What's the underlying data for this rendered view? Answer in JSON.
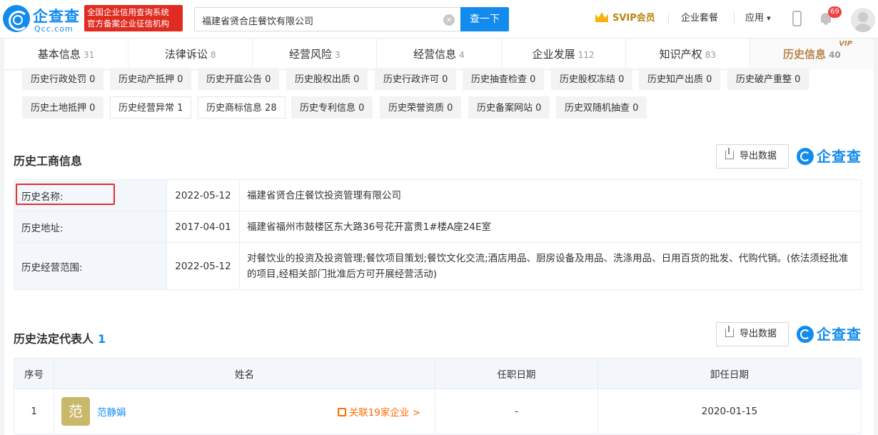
{
  "header": {
    "logo_cn": "企查查",
    "logo_en": "Qcc.com",
    "badge_line1": "全国企业信用查询系统",
    "badge_line2": "官方备案企业征信机构",
    "search_value": "福建省贤合庄餐饮有限公司",
    "search_button": "查一下",
    "svip": "SVIP会员",
    "package": "企业套餐",
    "apps": "应用",
    "apps_caret": "▾",
    "notif_count": "69"
  },
  "tabs": [
    {
      "label": "基本信息",
      "count": "31"
    },
    {
      "label": "法律诉讼",
      "count": "8"
    },
    {
      "label": "经营风险",
      "count": "3"
    },
    {
      "label": "经营信息",
      "count": "4"
    },
    {
      "label": "企业发展",
      "count": "112"
    },
    {
      "label": "知识产权",
      "count": "83"
    },
    {
      "label": "历史信息",
      "count": "40",
      "vip": "VIP"
    }
  ],
  "subtags": [
    "历史行政处罚 0",
    "历史动产抵押 0",
    "历史开庭公告 0",
    "历史股权出质 0",
    "历史行政许可 0",
    "历史抽查检查 0",
    "历史股权冻结 0",
    "历史知产出质 0",
    "历史破产重整 0",
    "历史土地抵押 0",
    "历史经营异常 1",
    "历史商标信息 28",
    "历史专利信息 0",
    "历史荣誉资质 0",
    "历史备案网站 0",
    "历史双随机抽查 0"
  ],
  "business": {
    "title": "历史工商信息",
    "export": "导出数据",
    "watermark": "企查查",
    "rows": [
      {
        "label": "历史名称:",
        "date": "2022-05-12",
        "value": "福建省贤合庄餐饮投资管理有限公司"
      },
      {
        "label": "历史地址:",
        "date": "2017-04-01",
        "value": "福建省福州市鼓楼区东大路36号花开富贵1#楼A座24E室"
      },
      {
        "label": "历史经营范围:",
        "date": "2022-05-12",
        "value": "对餐饮业的投资及投资管理;餐饮项目策划;餐饮文化交流;酒店用品、厨房设备及用品、洗涤用品、日用百货的批发、代购代销。(依法须经批准的项目,经相关部门批准后方可开展经营活动)"
      }
    ]
  },
  "legal_rep": {
    "title": "历史法定代表人",
    "count": "1",
    "export": "导出数据",
    "watermark": "企查查",
    "headers": [
      "序号",
      "姓名",
      "任职日期",
      "卸任日期"
    ],
    "rows": [
      {
        "index": "1",
        "avatar": "范",
        "name": "范静娟",
        "related": "关联19家企业 >",
        "start": "-",
        "end": "2020-01-15"
      }
    ]
  }
}
